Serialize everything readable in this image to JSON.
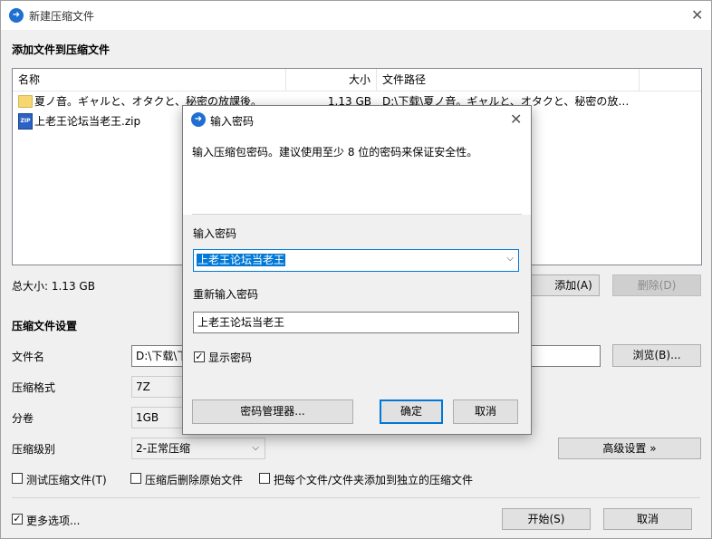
{
  "window": {
    "title": "新建压缩文件",
    "app_icon": "app-logo-icon",
    "accent": "#0078d7"
  },
  "files_section": {
    "title": "添加文件到压缩文件",
    "columns": {
      "name": "名称",
      "size": "大小",
      "path": "文件路径"
    },
    "rows": [
      {
        "icon": "folder-icon",
        "name": "夏ノ音。ギャルと、オタクと、秘密の放課後。",
        "size": "1.13 GB",
        "path": "D:\\下载\\夏ノ音。ギャルと、オタクと、秘密の放…"
      },
      {
        "icon": "zip-file-icon",
        "name": "上老王论坛当老王.zip",
        "size": "",
        "path": ""
      }
    ],
    "total_size": "总大小: 1.13 GB",
    "add_label": "添加(A)",
    "delete_label": "删除(D)"
  },
  "settings": {
    "title": "压缩文件设置",
    "filename_label": "文件名",
    "filename_value": "D:\\下载\\下",
    "browse_label": "浏览(B)...",
    "format_label": "压缩格式",
    "format_value": "7Z",
    "volume_label": "分卷",
    "volume_value": "1GB",
    "level_label": "压缩级别",
    "level_value": "2-正常压缩",
    "advanced_label": "高级设置 »",
    "test_label": "测试压缩文件(T)",
    "delete_after_label": "压缩后删除原始文件",
    "separate_label": "把每个文件/文件夹添加到独立的压缩文件"
  },
  "footer": {
    "more_options_label": "更多选项...",
    "start_label": "开始(S)",
    "cancel_label": "取消"
  },
  "dialog": {
    "title": "输入密码",
    "description": "输入压缩包密码。建议使用至少 8 位的密码来保证安全性。",
    "password_label": "输入密码",
    "password_value": "上老王论坛当老王",
    "confirm_label": "重新输入密码",
    "confirm_value": "上老王论坛当老王",
    "show_password_label": "显示密码",
    "manager_label": "密码管理器...",
    "ok_label": "确定",
    "cancel_label": "取消"
  }
}
